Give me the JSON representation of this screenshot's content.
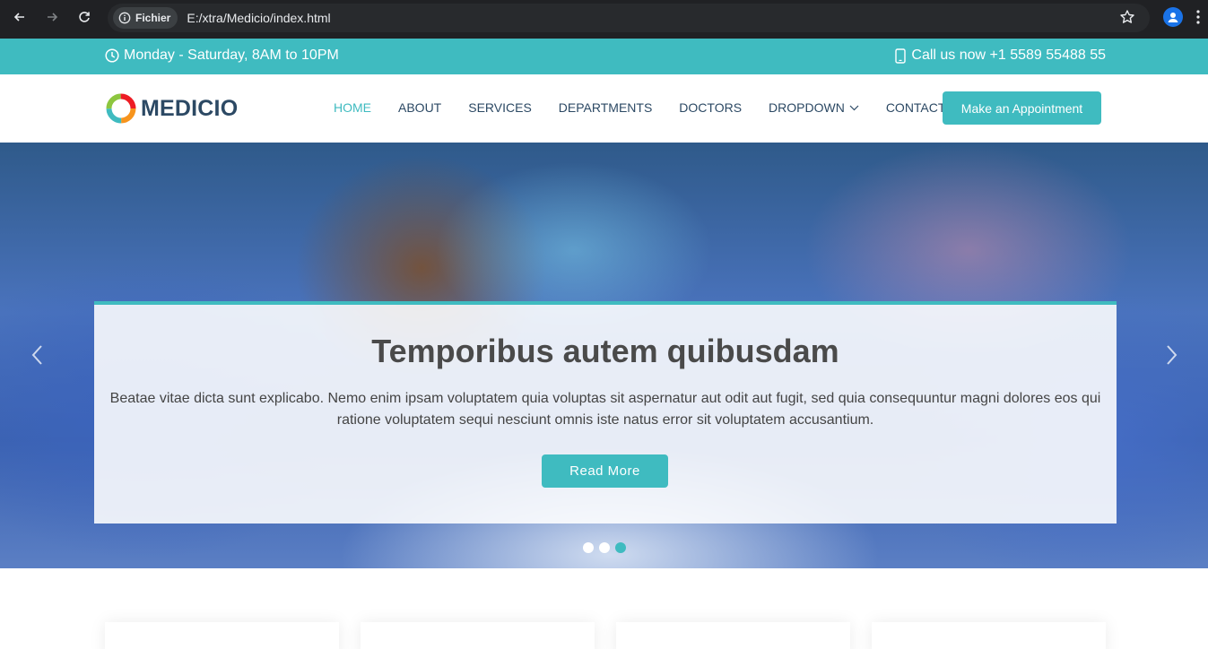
{
  "browser": {
    "site_chip": "Fichier",
    "url": "E:/xtra/Medicio/index.html"
  },
  "topbar": {
    "hours": "Monday - Saturday, 8AM to 10PM",
    "call": "Call us now +1 5589 55488 55"
  },
  "header": {
    "logo_text": "MEDICIO",
    "menu": [
      {
        "label": "HOME"
      },
      {
        "label": "ABOUT"
      },
      {
        "label": "SERVICES"
      },
      {
        "label": "DEPARTMENTS"
      },
      {
        "label": "DOCTORS"
      },
      {
        "label": "DROPDOWN"
      },
      {
        "label": "CONTACT"
      }
    ],
    "active_item": "HOME",
    "appointment_button": "Make an Appointment"
  },
  "hero": {
    "title": "Temporibus autem quibusdam",
    "text": "Beatae vitae dicta sunt explicabo. Nemo enim ipsam voluptatem quia voluptas sit aspernatur aut odit aut fugit, sed quia consequuntur magni dolores eos qui ratione voluptatem sequi nesciunt omnis iste natus error sit voluptatem accusantium.",
    "button": "Read More",
    "slides_total": 3,
    "active_slide": 3
  },
  "colors": {
    "accent": "#3fbbc0",
    "heading": "#2c4964"
  }
}
